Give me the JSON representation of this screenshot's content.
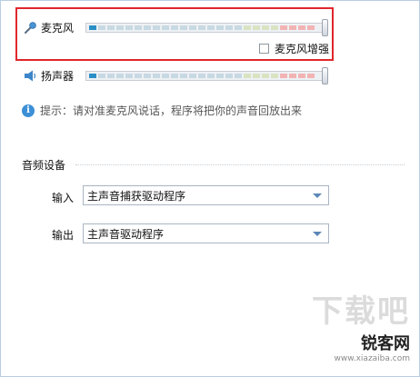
{
  "mic": {
    "label": "麦克风",
    "enhance_label": "麦克风增强",
    "enhance_checked": false
  },
  "speaker": {
    "label": "扬声器"
  },
  "hint": {
    "text": "提示：请对准麦克风说话，程序将把你的声音回放出来"
  },
  "audio_devices": {
    "title": "音频设备",
    "input": {
      "label": "输入",
      "value": "主声音捕获驱动程序"
    },
    "output": {
      "label": "输出",
      "value": "主声音驱动程序"
    }
  },
  "watermark": {
    "big": "下载吧",
    "logo": "锐客网",
    "url": "www.xiazaiba.com"
  },
  "colors": {
    "highlight": "#e0262c",
    "meter_low": "#2b8fc7",
    "meter_mid": "#c7d9e3",
    "meter_high": "#f2b3b3"
  }
}
